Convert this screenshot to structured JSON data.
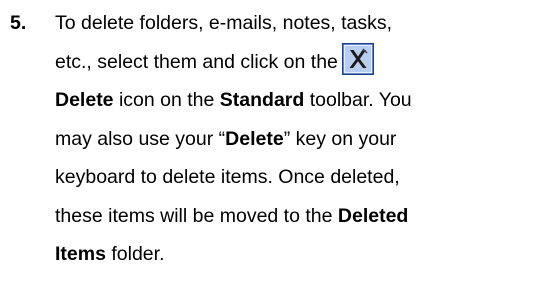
{
  "step": {
    "number": "5.",
    "line1": "To delete folders, e-mails, notes, tasks,",
    "line2_text": "etc., select them and click on the",
    "delete_icon": "delete-x-icon",
    "line3_delete": "Delete",
    "line3_mid": " icon on the ",
    "line3_standard": "Standard",
    "line3_end": " toolbar.  You",
    "line4_start": "may also use your “",
    "line4_delete": "Delete",
    "line4_end": "” key on your",
    "line5": "keyboard to delete items.  Once deleted,",
    "line6_start": "these items will be moved to the ",
    "line6_deleted": "Deleted",
    "line7_items": "Items",
    "line7_end": " folder."
  },
  "colors": {
    "text": "#000000",
    "icon_border": "#1c3f94",
    "icon_background": "#b8cef0",
    "icon_x": "#1a1a1a"
  }
}
